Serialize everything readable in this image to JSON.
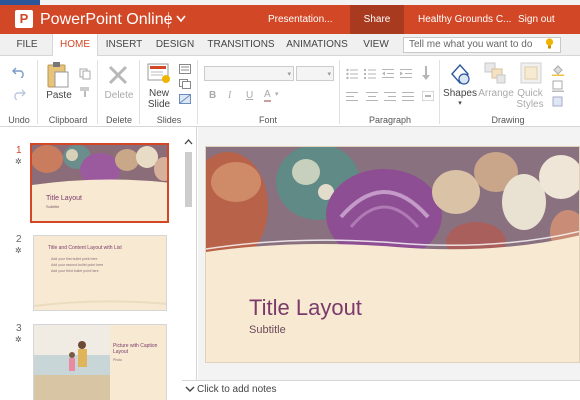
{
  "app": {
    "logo_letter": "P",
    "name": "PowerPoint Online",
    "doc_title": "Presentation...",
    "share_label": "Share",
    "org_name": "Healthy Grounds C...",
    "signout_label": "Sign out",
    "brand_color": "#d24726"
  },
  "tabs": [
    {
      "label": "FILE"
    },
    {
      "label": "HOME"
    },
    {
      "label": "INSERT"
    },
    {
      "label": "DESIGN"
    },
    {
      "label": "TRANSITIONS"
    },
    {
      "label": "ANIMATIONS"
    },
    {
      "label": "VIEW"
    }
  ],
  "tell_me": {
    "placeholder": "Tell me what you want to do",
    "icon": "lightbulb-icon"
  },
  "ribbon": {
    "groups": {
      "undo": "Undo",
      "clipboard": "Clipboard",
      "delete": "Delete",
      "slides": "Slides",
      "font": "Font",
      "paragraph": "Paragraph",
      "drawing": "Drawing"
    },
    "buttons": {
      "paste": "Paste",
      "delete": "Delete",
      "new_slide_1": "New",
      "new_slide_2": "Slide",
      "shapes": "Shapes",
      "arrange": "Arrange",
      "quick_styles_1": "Quick",
      "quick_styles_2": "Styles"
    },
    "font_buttons": [
      "B",
      "I",
      "U",
      "A"
    ]
  },
  "thumbnails": [
    {
      "number": "1",
      "title": "Title Layout",
      "subtitle": "Subtitle"
    },
    {
      "number": "2",
      "title": "Title and Content Layout with List",
      "bullets": [
        "Add your first bullet point here",
        "Add your second bullet point here",
        "Add your third bullet point here"
      ]
    },
    {
      "number": "3",
      "title": "Picture with Caption Layout",
      "caption": "Photo"
    }
  ],
  "slide": {
    "title": "Title Layout",
    "subtitle": "Subtitle"
  },
  "notes": {
    "placeholder": "Click to add notes"
  }
}
